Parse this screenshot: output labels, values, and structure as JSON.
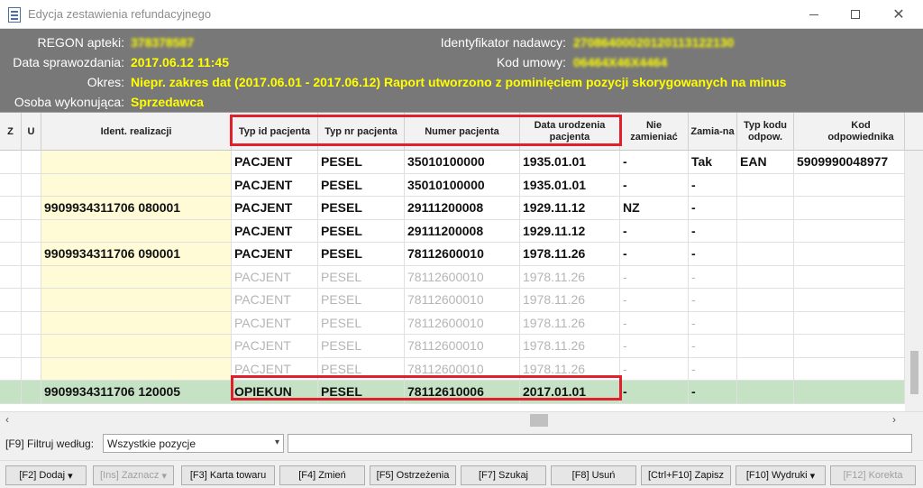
{
  "window": {
    "title": "Edycja zestawienia refundacyjnego"
  },
  "info": {
    "regon_label": "REGON apteki:",
    "regon_value": "378378587",
    "data_label": "Data sprawozdania:",
    "data_value": "2017.06.12 11:45",
    "okres_label": "Okres:",
    "okres_value": "Niepr. zakres dat (2017.06.01 - 2017.06.12) Raport utworzono z pominięciem pozycji skorygowanych na minus",
    "osoba_label": "Osoba wykonująca:",
    "osoba_value": "Sprzedawca",
    "ident_label": "Identyfikator nadawcy:",
    "ident_value": "27086400020120113122130",
    "kod_label": "Kod umowy:",
    "kod_value": "06464X46X4464"
  },
  "grid": {
    "headers": {
      "z": "Z",
      "u": "U",
      "ident": "Ident. realizacji",
      "typ_id": "Typ id pacjenta",
      "typ_nr": "Typ nr pacjenta",
      "numer": "Numer pacjenta",
      "data_ur": "Data urodzenia pacjenta",
      "nie_zam": "Nie zamieniać",
      "zamiana": "Zamia-na",
      "typ_kodu": "Typ kodu odpow.",
      "kod_odp": "Kod odpowiednika"
    },
    "rows": [
      {
        "ident": "",
        "typ_id": "PACJENT",
        "typ_nr": "PESEL",
        "numer": "35010100000",
        "data_ur": "1935.01.01",
        "nie_zam": "-",
        "zamiana": "Tak",
        "typ_kodu": "EAN",
        "kod_odp": "5909990048977"
      },
      {
        "ident": "",
        "typ_id": "PACJENT",
        "typ_nr": "PESEL",
        "numer": "35010100000",
        "data_ur": "1935.01.01",
        "nie_zam": "-",
        "zamiana": "-",
        "typ_kodu": "",
        "kod_odp": ""
      },
      {
        "ident": "9909934311706  080001",
        "typ_id": "PACJENT",
        "typ_nr": "PESEL",
        "numer": "29111200008",
        "data_ur": "1929.11.12",
        "nie_zam": "NZ",
        "zamiana": "-",
        "typ_kodu": "",
        "kod_odp": ""
      },
      {
        "ident": "",
        "typ_id": "PACJENT",
        "typ_nr": "PESEL",
        "numer": "29111200008",
        "data_ur": "1929.11.12",
        "nie_zam": "-",
        "zamiana": "-",
        "typ_kodu": "",
        "kod_odp": ""
      },
      {
        "ident": "9909934311706  090001",
        "typ_id": "PACJENT",
        "typ_nr": "PESEL",
        "numer": "78112600010",
        "data_ur": "1978.11.26",
        "nie_zam": "-",
        "zamiana": "-",
        "typ_kodu": "",
        "kod_odp": ""
      },
      {
        "ident": "",
        "typ_id": "PACJENT",
        "typ_nr": "PESEL",
        "numer": "78112600010",
        "data_ur": "1978.11.26",
        "nie_zam": "-",
        "zamiana": "-",
        "typ_kodu": "",
        "kod_odp": ""
      },
      {
        "ident": "",
        "typ_id": "PACJENT",
        "typ_nr": "PESEL",
        "numer": "78112600010",
        "data_ur": "1978.11.26",
        "nie_zam": "-",
        "zamiana": "-",
        "typ_kodu": "",
        "kod_odp": ""
      },
      {
        "ident": "",
        "typ_id": "PACJENT",
        "typ_nr": "PESEL",
        "numer": "78112600010",
        "data_ur": "1978.11.26",
        "nie_zam": "-",
        "zamiana": "-",
        "typ_kodu": "",
        "kod_odp": ""
      },
      {
        "ident": "",
        "typ_id": "PACJENT",
        "typ_nr": "PESEL",
        "numer": "78112600010",
        "data_ur": "1978.11.26",
        "nie_zam": "-",
        "zamiana": "-",
        "typ_kodu": "",
        "kod_odp": ""
      },
      {
        "ident": "",
        "typ_id": "PACJENT",
        "typ_nr": "PESEL",
        "numer": "78112600010",
        "data_ur": "1978.11.26",
        "nie_zam": "-",
        "zamiana": "-",
        "typ_kodu": "",
        "kod_odp": ""
      },
      {
        "ident": "9909934311706  120005",
        "typ_id": "OPIEKUN",
        "typ_nr": "PESEL",
        "numer": "78112610006",
        "data_ur": "2017.01.01",
        "nie_zam": "-",
        "zamiana": "-",
        "typ_kodu": "",
        "kod_odp": ""
      }
    ]
  },
  "filter": {
    "label": "[F9] Filtruj według:",
    "selected": "Wszystkie pozycje",
    "text": ""
  },
  "toolbar": {
    "dodaj": "[F2] Dodaj",
    "zaznacz": "[Ins] Zaznacz",
    "karta": "[F3] Karta towaru",
    "zmien": "[F4] Zmień",
    "ostrzezenia": "[F5] Ostrzeżenia",
    "szukaj": "[F7] Szukaj",
    "usun": "[F8] Usuń",
    "zapisz": "[Ctrl+F10] Zapisz",
    "wydruki": "[F10] Wydruki",
    "korekta": "[F12] Korekta"
  },
  "colors": {
    "info_bg": "#787878",
    "info_value": "#ffff00",
    "highlight": "#e0202a",
    "selected_row": "#c6e2c5",
    "ident_bg": "#fffbd6"
  }
}
